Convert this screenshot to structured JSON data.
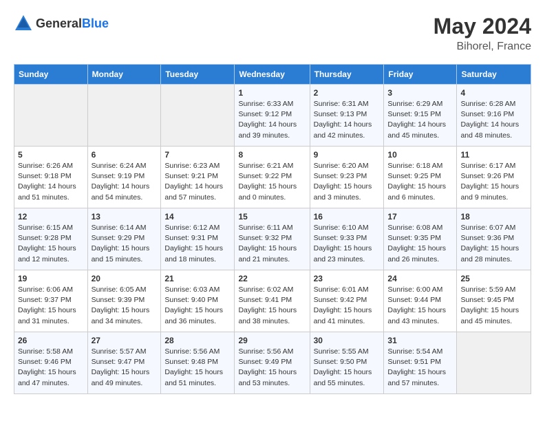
{
  "logo": {
    "text_general": "General",
    "text_blue": "Blue"
  },
  "title": {
    "month_year": "May 2024",
    "location": "Bihorel, France"
  },
  "weekdays": [
    "Sunday",
    "Monday",
    "Tuesday",
    "Wednesday",
    "Thursday",
    "Friday",
    "Saturday"
  ],
  "weeks": [
    [
      {
        "day": "",
        "info": ""
      },
      {
        "day": "",
        "info": ""
      },
      {
        "day": "",
        "info": ""
      },
      {
        "day": "1",
        "info": "Sunrise: 6:33 AM\nSunset: 9:12 PM\nDaylight: 14 hours and 39 minutes."
      },
      {
        "day": "2",
        "info": "Sunrise: 6:31 AM\nSunset: 9:13 PM\nDaylight: 14 hours and 42 minutes."
      },
      {
        "day": "3",
        "info": "Sunrise: 6:29 AM\nSunset: 9:15 PM\nDaylight: 14 hours and 45 minutes."
      },
      {
        "day": "4",
        "info": "Sunrise: 6:28 AM\nSunset: 9:16 PM\nDaylight: 14 hours and 48 minutes."
      }
    ],
    [
      {
        "day": "5",
        "info": "Sunrise: 6:26 AM\nSunset: 9:18 PM\nDaylight: 14 hours and 51 minutes."
      },
      {
        "day": "6",
        "info": "Sunrise: 6:24 AM\nSunset: 9:19 PM\nDaylight: 14 hours and 54 minutes."
      },
      {
        "day": "7",
        "info": "Sunrise: 6:23 AM\nSunset: 9:21 PM\nDaylight: 14 hours and 57 minutes."
      },
      {
        "day": "8",
        "info": "Sunrise: 6:21 AM\nSunset: 9:22 PM\nDaylight: 15 hours and 0 minutes."
      },
      {
        "day": "9",
        "info": "Sunrise: 6:20 AM\nSunset: 9:23 PM\nDaylight: 15 hours and 3 minutes."
      },
      {
        "day": "10",
        "info": "Sunrise: 6:18 AM\nSunset: 9:25 PM\nDaylight: 15 hours and 6 minutes."
      },
      {
        "day": "11",
        "info": "Sunrise: 6:17 AM\nSunset: 9:26 PM\nDaylight: 15 hours and 9 minutes."
      }
    ],
    [
      {
        "day": "12",
        "info": "Sunrise: 6:15 AM\nSunset: 9:28 PM\nDaylight: 15 hours and 12 minutes."
      },
      {
        "day": "13",
        "info": "Sunrise: 6:14 AM\nSunset: 9:29 PM\nDaylight: 15 hours and 15 minutes."
      },
      {
        "day": "14",
        "info": "Sunrise: 6:12 AM\nSunset: 9:31 PM\nDaylight: 15 hours and 18 minutes."
      },
      {
        "day": "15",
        "info": "Sunrise: 6:11 AM\nSunset: 9:32 PM\nDaylight: 15 hours and 21 minutes."
      },
      {
        "day": "16",
        "info": "Sunrise: 6:10 AM\nSunset: 9:33 PM\nDaylight: 15 hours and 23 minutes."
      },
      {
        "day": "17",
        "info": "Sunrise: 6:08 AM\nSunset: 9:35 PM\nDaylight: 15 hours and 26 minutes."
      },
      {
        "day": "18",
        "info": "Sunrise: 6:07 AM\nSunset: 9:36 PM\nDaylight: 15 hours and 28 minutes."
      }
    ],
    [
      {
        "day": "19",
        "info": "Sunrise: 6:06 AM\nSunset: 9:37 PM\nDaylight: 15 hours and 31 minutes."
      },
      {
        "day": "20",
        "info": "Sunrise: 6:05 AM\nSunset: 9:39 PM\nDaylight: 15 hours and 34 minutes."
      },
      {
        "day": "21",
        "info": "Sunrise: 6:03 AM\nSunset: 9:40 PM\nDaylight: 15 hours and 36 minutes."
      },
      {
        "day": "22",
        "info": "Sunrise: 6:02 AM\nSunset: 9:41 PM\nDaylight: 15 hours and 38 minutes."
      },
      {
        "day": "23",
        "info": "Sunrise: 6:01 AM\nSunset: 9:42 PM\nDaylight: 15 hours and 41 minutes."
      },
      {
        "day": "24",
        "info": "Sunrise: 6:00 AM\nSunset: 9:44 PM\nDaylight: 15 hours and 43 minutes."
      },
      {
        "day": "25",
        "info": "Sunrise: 5:59 AM\nSunset: 9:45 PM\nDaylight: 15 hours and 45 minutes."
      }
    ],
    [
      {
        "day": "26",
        "info": "Sunrise: 5:58 AM\nSunset: 9:46 PM\nDaylight: 15 hours and 47 minutes."
      },
      {
        "day": "27",
        "info": "Sunrise: 5:57 AM\nSunset: 9:47 PM\nDaylight: 15 hours and 49 minutes."
      },
      {
        "day": "28",
        "info": "Sunrise: 5:56 AM\nSunset: 9:48 PM\nDaylight: 15 hours and 51 minutes."
      },
      {
        "day": "29",
        "info": "Sunrise: 5:56 AM\nSunset: 9:49 PM\nDaylight: 15 hours and 53 minutes."
      },
      {
        "day": "30",
        "info": "Sunrise: 5:55 AM\nSunset: 9:50 PM\nDaylight: 15 hours and 55 minutes."
      },
      {
        "day": "31",
        "info": "Sunrise: 5:54 AM\nSunset: 9:51 PM\nDaylight: 15 hours and 57 minutes."
      },
      {
        "day": "",
        "info": ""
      }
    ]
  ]
}
